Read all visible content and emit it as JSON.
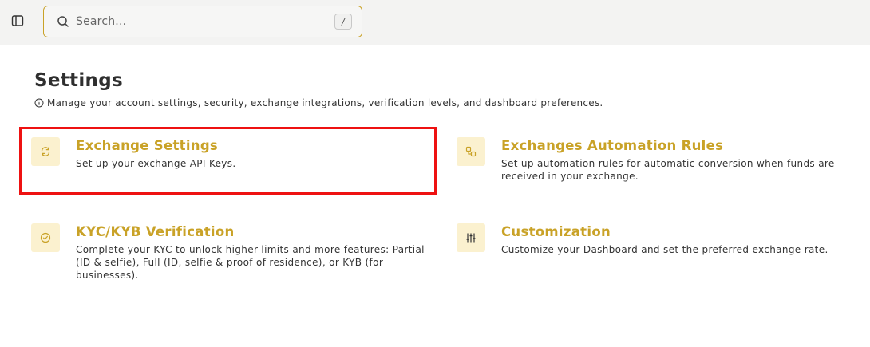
{
  "search": {
    "placeholder": "Search...",
    "shortcut": "/"
  },
  "page": {
    "title": "Settings",
    "subtitle": "Manage your account settings, security, exchange integrations, verification levels, and dashboard preferences."
  },
  "cards": [
    {
      "title": "Exchange Settings",
      "description": "Set up your exchange API Keys.",
      "icon": "refresh-icon"
    },
    {
      "title": "Exchanges Automation Rules",
      "description": "Set up automation rules for automatic conversion when funds are received in your exchange.",
      "icon": "workflow-icon"
    },
    {
      "title": "KYC/KYB Verification",
      "description": "Complete your KYC to unlock higher limits and more features: Partial (ID & selfie), Full (ID, selfie & proof of residence), or KYB (for businesses).",
      "icon": "check-circle-icon"
    },
    {
      "title": "Customization",
      "description": "Customize your Dashboard and set the preferred exchange rate.",
      "icon": "sliders-icon"
    }
  ],
  "colors": {
    "accent": "#c9a227",
    "tile": "#fbf1cf",
    "highlight": "#ee1111"
  }
}
